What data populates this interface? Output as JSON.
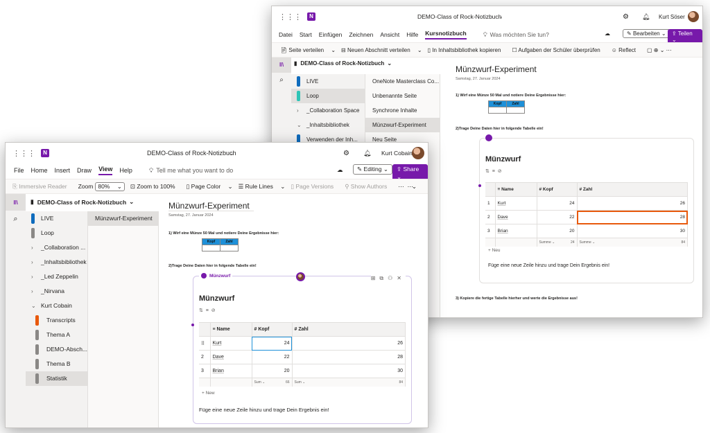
{
  "back_window": {
    "title": "DEMO-Class of Rock-Notizbuch",
    "user": "Kurt Söser",
    "menu": [
      "Datei",
      "Start",
      "Einfügen",
      "Zeichnen",
      "Ansicht",
      "Hilfe",
      "Kursnotizbuch"
    ],
    "search": "Was möchten Sie tun?",
    "edit": "Bearbeiten",
    "share": "Teilen",
    "ribbon": [
      "Seite verteilen",
      "Neuen Abschnitt verteilen",
      "In Inhaltsbibliothek kopieren",
      "Aufgaben der Schüler überprüfen",
      "Reflect"
    ],
    "notebook": "DEMO-Class of Rock-Notizbuch",
    "sections": [
      {
        "label": "LIVE",
        "color": "#0f6cbd"
      },
      {
        "label": "Loop",
        "color": "#2ec4b6"
      },
      {
        "label": "_Collaboration Space",
        "chev": ">"
      },
      {
        "label": "_Inhaltsbibliothek",
        "chev": "v"
      },
      {
        "label": "Verwenden der Inh...",
        "color": "#0f6cbd"
      }
    ],
    "pages": [
      "OneNote Masterclass Co...",
      "Unbenannte Seite",
      "Synchrone Inhalte",
      "Münzwurf-Experiment",
      "Neu Seite"
    ],
    "page_title": "Münzwurf-Experiment",
    "page_date": "Samstag, 27. Januar 2024",
    "step1": "1) Wirf eine Münze 50 Mal und notiere Deine Ergebnisse hier:",
    "mini_head": [
      "Kopf",
      "Zahl"
    ],
    "step2": "2)Trage Deine Daten hier in folgende Tabelle ein!",
    "loop_title": "Münzwurf",
    "cols": [
      "Name",
      "Kopf",
      "Zahl"
    ],
    "rows": [
      [
        "1",
        "Kurt",
        "24",
        "26"
      ],
      [
        "2",
        "Dave",
        "22",
        "28"
      ],
      [
        "3",
        "Brian",
        "20",
        "30"
      ]
    ],
    "sum_label": "Summe ⌄",
    "sum_kopf": "24",
    "sum_zahl": "84",
    "new": "+ Neu",
    "hint": "Füge eine neue Zeile hinzu und trage Dein Ergebnis ein!",
    "step3": "3) Kopiere die fertige Tabelle hierher und werte die Ergebnisse aus!"
  },
  "front_window": {
    "title": "DEMO-Class of Rock-Notizbuch",
    "user": "Kurt Cobain",
    "menu": [
      "File",
      "Home",
      "Insert",
      "Draw",
      "View",
      "Help"
    ],
    "search": "Tell me what you want to do",
    "edit": "Editing",
    "share": "Share",
    "ribbon": {
      "immersive": "Immersive Reader",
      "zoom": "Zoom",
      "zoom_val": "80%",
      "zoom100": "Zoom to 100%",
      "page_color": "Page Color",
      "rule_lines": "Rule Lines",
      "page_versions": "Page Versions",
      "show_authors": "Show Authors"
    },
    "notebook": "DEMO-Class of Rock-Notizbuch",
    "sections": [
      {
        "label": "LIVE",
        "color": "#0f6cbd"
      },
      {
        "label": "Loop",
        "color": "#8a8886"
      },
      {
        "label": "_Collaboration ...",
        "chev": ">"
      },
      {
        "label": "_Inhaltsbibliothek",
        "chev": ">"
      },
      {
        "label": "_Led Zeppelin",
        "chev": ">"
      },
      {
        "label": "_Nirvana",
        "chev": ">"
      },
      {
        "label": "Kurt Cobain",
        "chev": "v"
      },
      {
        "label": "Transcripts",
        "color": "#e8590c",
        "sub": true
      },
      {
        "label": "Thema A",
        "color": "#8a8886",
        "sub": true
      },
      {
        "label": "DEMO-Absch...",
        "color": "#8a8886",
        "sub": true
      },
      {
        "label": "Thema B",
        "color": "#8a8886",
        "sub": true
      },
      {
        "label": "Statistik",
        "color": "#8a8886",
        "sub": true,
        "sel": true
      }
    ],
    "pages": [
      "Münzwurf-Experiment"
    ],
    "page_title": "Münzwurf-Experiment",
    "page_date": "Samstag, 27. Januar 2024",
    "step1": "1) Wirf eine Münze 50 Mal und notiere Deine Ergebnisse hier:",
    "mini_head": [
      "Kopf",
      "Zahl"
    ],
    "step2": "2)Trage Deine Daten hier in folgende Tabelle ein!",
    "loop_label": "Münzwurf",
    "loop_title": "Münzwurf",
    "cols": [
      "Name",
      "Kopf",
      "Zahl"
    ],
    "rows": [
      [
        "⠿",
        "Kurt",
        "24",
        "26"
      ],
      [
        "2",
        "Dave",
        "22",
        "28"
      ],
      [
        "3",
        "Brian",
        "20",
        "30"
      ]
    ],
    "sum_label": "Sum ⌄",
    "sum_kopf": "66",
    "sum_zahl": "84",
    "new": "+ New",
    "hint": "Füge eine neue Zeile hinzu und trage Dein Ergebnis ein!"
  },
  "colors": {
    "onenote": "#7719aa",
    "accent_blue": "#1e90d8",
    "highlight": "#e8590c"
  }
}
